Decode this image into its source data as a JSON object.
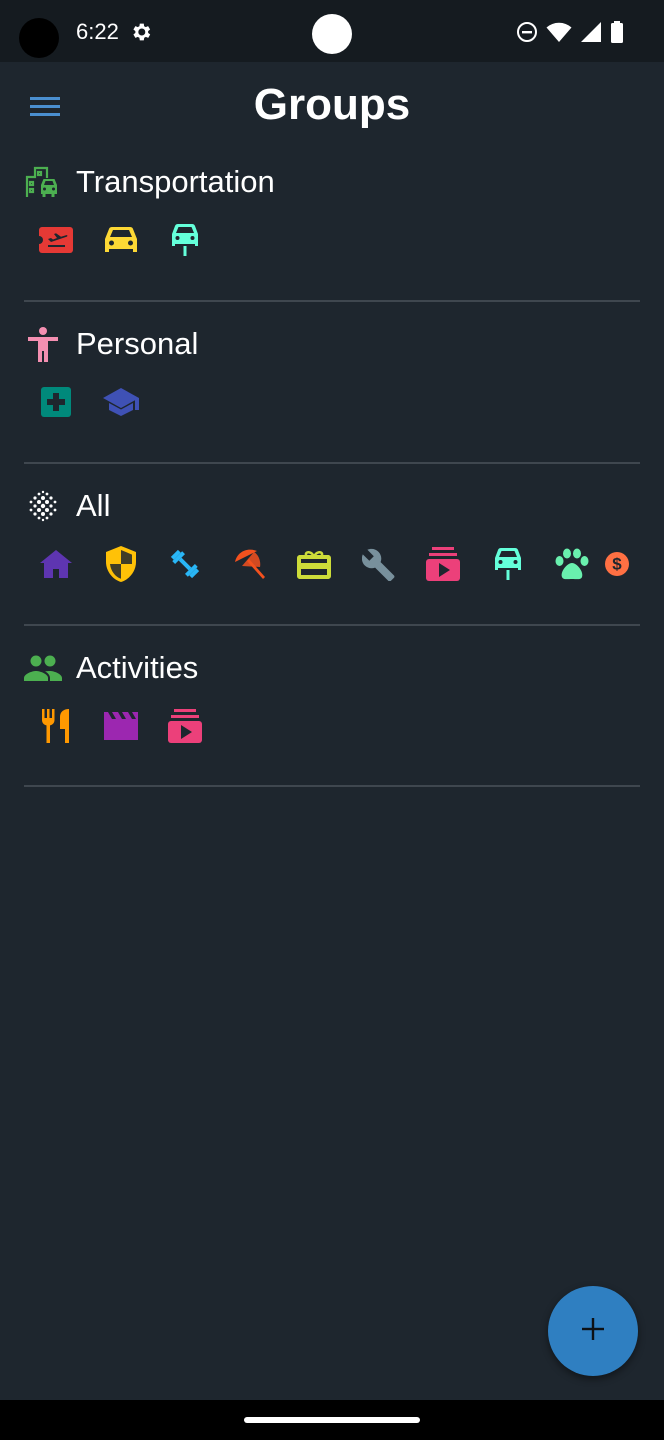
{
  "status_bar": {
    "time": "6:22"
  },
  "app_bar": {
    "title": "Groups"
  },
  "groups": [
    {
      "title": "Transportation",
      "icon": "city-car-icon",
      "color": "#4caf50",
      "items": [
        {
          "name": "airplane-ticket-icon",
          "color": "#e53935"
        },
        {
          "name": "car-icon",
          "color": "#fdd835"
        },
        {
          "name": "electric-car-icon",
          "color": "#64ffda"
        }
      ]
    },
    {
      "title": "Personal",
      "icon": "accessibility-icon",
      "color": "#f48fb1",
      "items": [
        {
          "name": "medical-icon",
          "color": "#00897b"
        },
        {
          "name": "school-icon",
          "color": "#3f51b5"
        }
      ]
    },
    {
      "title": "All",
      "icon": "grid-dots-icon",
      "color": "#ffffff",
      "items": [
        {
          "name": "home-icon",
          "color": "#5e35b1"
        },
        {
          "name": "security-shield-icon",
          "color": "#ffc107"
        },
        {
          "name": "fitness-icon",
          "color": "#29b6f6"
        },
        {
          "name": "beach-umbrella-icon",
          "color": "#f4511e"
        },
        {
          "name": "gift-card-icon",
          "color": "#cddc39"
        },
        {
          "name": "wrench-icon",
          "color": "#78909c"
        },
        {
          "name": "subscriptions-icon",
          "color": "#ec407a"
        },
        {
          "name": "electric-car-icon",
          "color": "#64ffda"
        },
        {
          "name": "pets-icon",
          "color": "#69f0ae"
        },
        {
          "name": "money-icon",
          "color": "#ff7043"
        }
      ]
    },
    {
      "title": "Activities",
      "icon": "people-icon",
      "color": "#4caf50",
      "items": [
        {
          "name": "restaurant-icon",
          "color": "#ff9800"
        },
        {
          "name": "movie-icon",
          "color": "#9c27b0"
        },
        {
          "name": "subscriptions-icon",
          "color": "#ec407a"
        }
      ]
    }
  ],
  "fab": {
    "label": "+",
    "color": "#2f7fc1"
  }
}
